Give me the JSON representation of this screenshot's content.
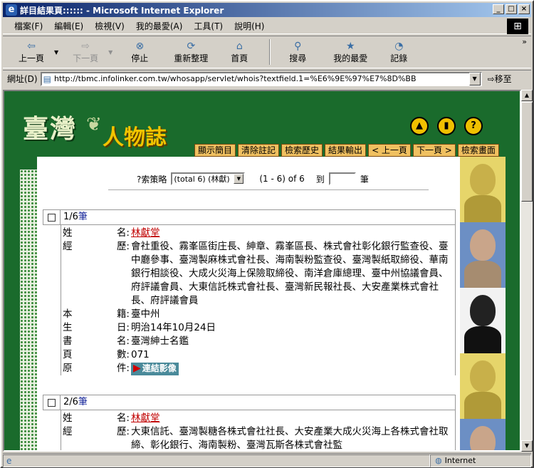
{
  "window": {
    "title": "詳目結果頁:::::: - Microsoft Internet Explorer"
  },
  "menu": [
    "檔案(F)",
    "編輯(E)",
    "檢視(V)",
    "我的最愛(A)",
    "工具(T)",
    "說明(H)"
  ],
  "toolbar": {
    "back": "上一頁",
    "forward": "下一頁",
    "stop": "停止",
    "refresh": "重新整理",
    "home": "首頁",
    "search": "搜尋",
    "favorites": "我的最愛",
    "history": "記錄",
    "more": "»"
  },
  "address": {
    "label": "網址(D)",
    "url": "http://tbmc.infolinker.com.tw/whosapp/servlet/whois?textfield.1=%E6%9E%97%E7%8D%BB",
    "go": "移至"
  },
  "status": {
    "zone": "Internet"
  },
  "site": {
    "logo_main": "臺灣",
    "logo_sub": "人物誌",
    "icons": [
      "up-arrow-icon",
      "book-icon",
      "help-icon"
    ],
    "nav": [
      "顯示簡目",
      "清除註記",
      "檢索歷史",
      "結果輸出",
      "< 上一頁",
      "下一頁 >",
      "檢索畫面"
    ]
  },
  "strategy": {
    "label": "?索策略",
    "selected": "(total 6) (林獻)",
    "range": "(1 - 6) of 6",
    "goto_label": "到",
    "unit": "筆"
  },
  "records": [
    {
      "num": "1/6",
      "unit": "筆",
      "rows": [
        {
          "l1": "姓",
          "l2": "名:",
          "value": "林獻堂",
          "link": true
        },
        {
          "l1": "經",
          "l2": "歷:",
          "value": "會社重役、霧峯區街庄長、紳章、霧峯區長、株式會社彰化銀行監查役、臺中廳參事、臺灣製麻株式會社長、海南製粉監查役、臺灣製紙取締役、華南銀行相談役、大成火災海上保險取締役、南洋倉庫總理、臺中州協議會員、府評議會員、大東信託株式會社長、臺灣新民報社長、大安產業株式會社長、府評議會員"
        },
        {
          "l1": "本",
          "l2": "籍:",
          "value": "臺中州"
        },
        {
          "l1": "生",
          "l2": "日:",
          "value": "明治14年10月24日"
        },
        {
          "l1": "書",
          "l2": "名:",
          "value": "臺灣紳士名鑑"
        },
        {
          "l1": "頁",
          "l2": "數:",
          "value": "071"
        },
        {
          "l1": "原",
          "l2": "件:",
          "value": "連結影像",
          "image": true
        }
      ]
    },
    {
      "num": "2/6",
      "unit": "筆",
      "rows": [
        {
          "l1": "姓",
          "l2": "名:",
          "value": "林獻堂",
          "link": true
        },
        {
          "l1": "經",
          "l2": "歷:",
          "value": "大東信託、臺灣製糖各株式會社社長、大安產業大成火災海上各株式會社取締、彰化銀行、海南製粉、臺灣瓦斯各株式會社監"
        }
      ]
    }
  ]
}
